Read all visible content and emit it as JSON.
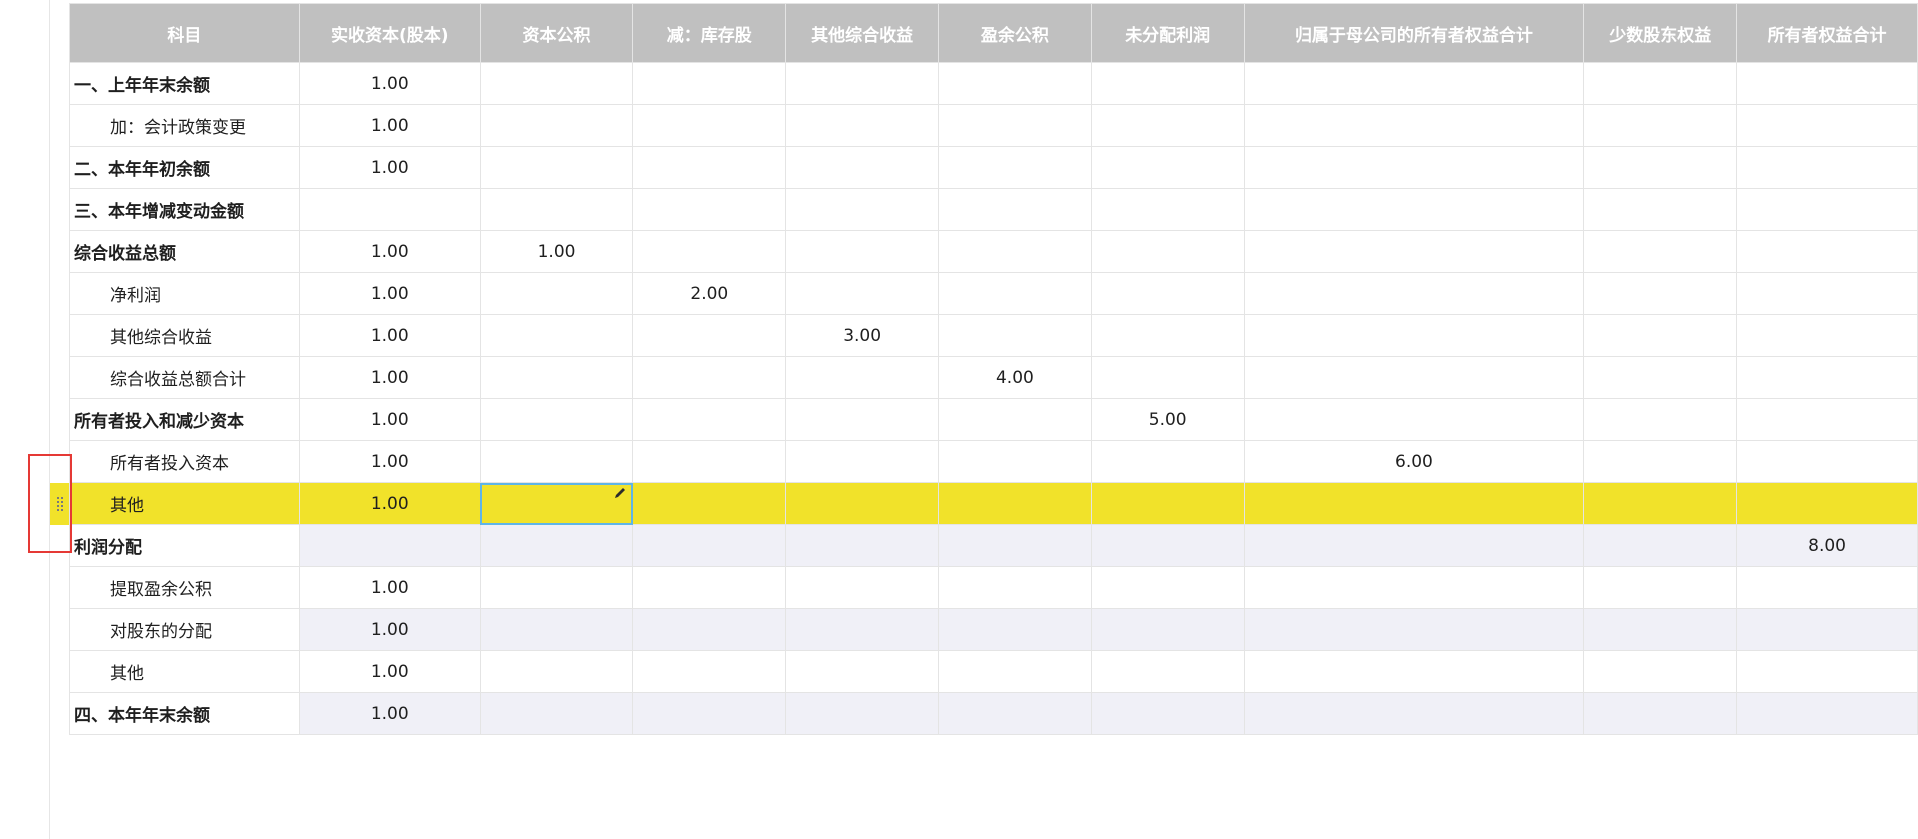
{
  "table": {
    "headers": [
      "科目",
      "实收资本(股本)",
      "资本公积",
      "减：库存股",
      "其他综合收益",
      "盈余公积",
      "未分配利润",
      "归属于母公司的所有者权益合计",
      "少数股东权益",
      "所有者权益合计"
    ],
    "rows": [
      {
        "label": "一、上年年末余额",
        "cells": [
          "1.00",
          "",
          "",
          "",
          "",
          "",
          "",
          "",
          ""
        ]
      },
      {
        "label": "加：会计政策变更",
        "cells": [
          "1.00",
          "",
          "",
          "",
          "",
          "",
          "",
          "",
          ""
        ]
      },
      {
        "label": "二、本年年初余额",
        "cells": [
          "1.00",
          "",
          "",
          "",
          "",
          "",
          "",
          "",
          ""
        ]
      },
      {
        "label": "三、本年增减变动金额",
        "cells": [
          "",
          "",
          "",
          "",
          "",
          "",
          "",
          "",
          ""
        ]
      },
      {
        "label": "综合收益总额",
        "cells": [
          "1.00",
          "1.00",
          "",
          "",
          "",
          "",
          "",
          "",
          ""
        ]
      },
      {
        "label": "净利润",
        "cells": [
          "1.00",
          "",
          "2.00",
          "",
          "",
          "",
          "",
          "",
          ""
        ]
      },
      {
        "label": "其他综合收益",
        "cells": [
          "1.00",
          "",
          "",
          "3.00",
          "",
          "",
          "",
          "",
          ""
        ]
      },
      {
        "label": "综合收益总额合计",
        "cells": [
          "1.00",
          "",
          "",
          "",
          "4.00",
          "",
          "",
          "",
          ""
        ]
      },
      {
        "label": "所有者投入和减少资本",
        "cells": [
          "1.00",
          "",
          "",
          "",
          "",
          "5.00",
          "",
          "",
          ""
        ]
      },
      {
        "label": "所有者投入资本",
        "cells": [
          "1.00",
          "",
          "",
          "",
          "",
          "",
          "6.00",
          "",
          ""
        ]
      },
      {
        "label": "其他",
        "cells": [
          "1.00",
          "",
          "",
          "",
          "",
          "",
          "",
          "",
          ""
        ]
      },
      {
        "label": "利润分配",
        "cells": [
          "",
          "",
          "",
          "",
          "",
          "",
          "",
          "",
          "8.00"
        ]
      },
      {
        "label": "提取盈余公积",
        "cells": [
          "1.00",
          "",
          "",
          "",
          "",
          "",
          "",
          "",
          ""
        ]
      },
      {
        "label": "对股东的分配",
        "cells": [
          "1.00",
          "",
          "",
          "",
          "",
          "",
          "",
          "",
          ""
        ]
      },
      {
        "label": "其他",
        "cells": [
          "1.00",
          "",
          "",
          "",
          "",
          "",
          "",
          "",
          ""
        ]
      },
      {
        "label": "四、本年年末余额",
        "cells": [
          "1.00",
          "",
          "",
          "",
          "",
          "",
          "",
          "",
          ""
        ]
      }
    ]
  },
  "colors": {
    "header_bg": "#c0c0c0",
    "selected_row": "#f1e22a",
    "active_cell_border": "#5fb5e8",
    "shaded_row": "#f0f0f7",
    "highlight_box": "#e53935"
  },
  "icons": {
    "edit": "pencil-icon",
    "drag": "drag-handle-icon"
  }
}
